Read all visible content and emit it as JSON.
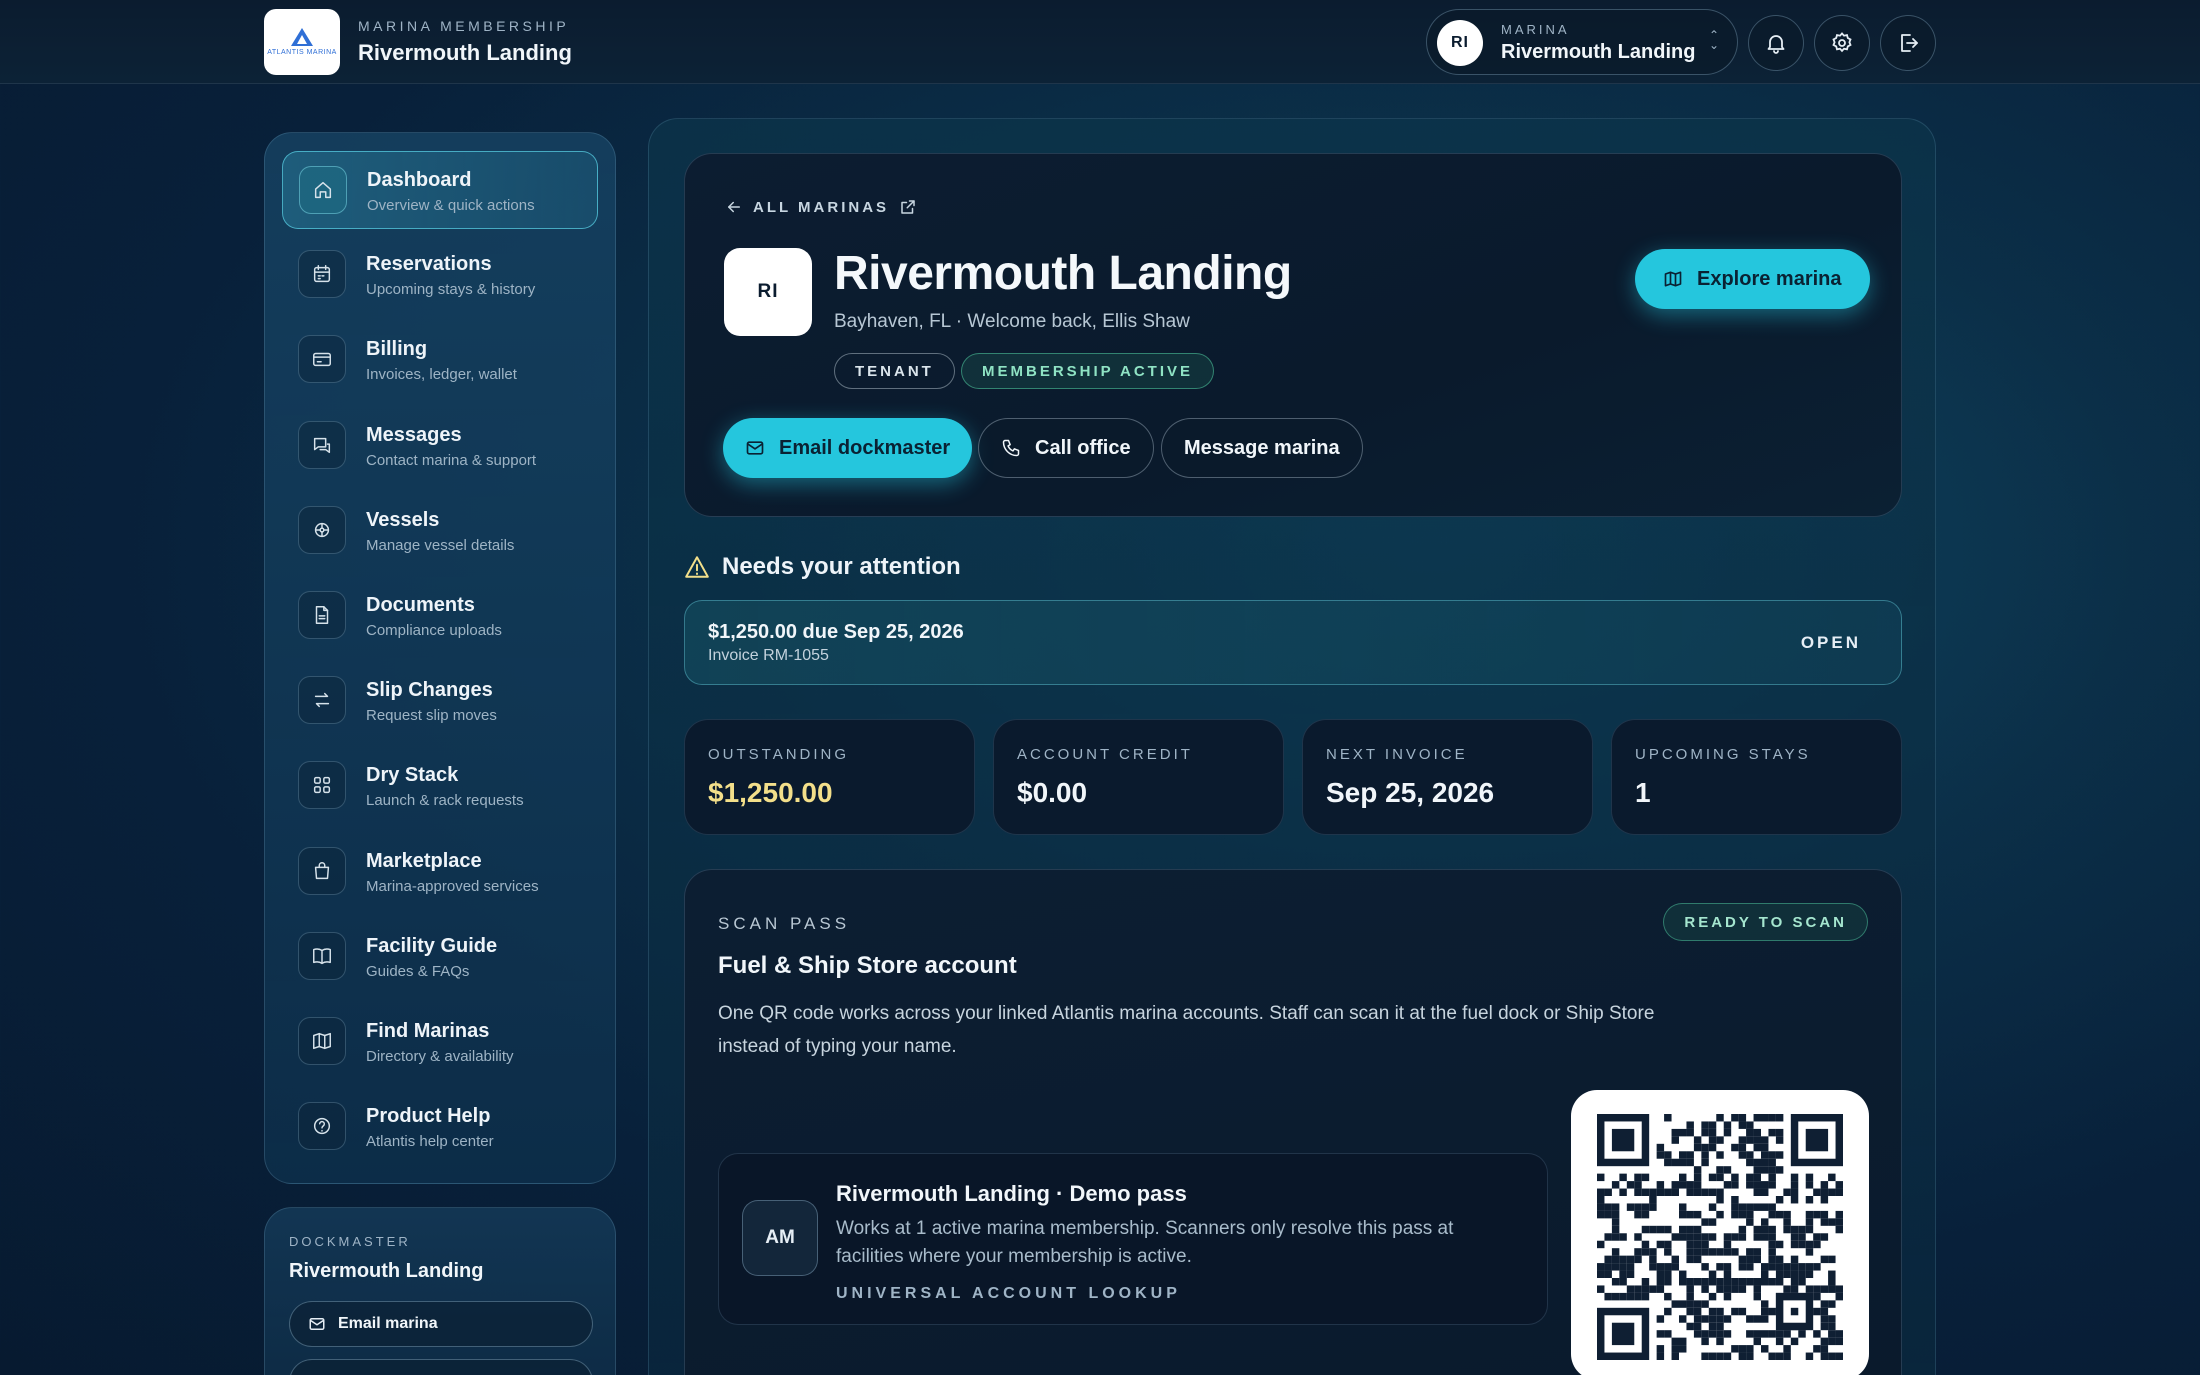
{
  "brand": {
    "logo_text": "ATLANTIS MARINA",
    "kicker": "MARINA MEMBERSHIP",
    "title": "Rivermouth Landing"
  },
  "marina_switcher": {
    "avatar": "RI",
    "kicker": "MARINA",
    "name": "Rivermouth Landing"
  },
  "header_icons": [
    "bell-icon",
    "gear-icon",
    "logout-icon"
  ],
  "sidebar": {
    "items": [
      {
        "label": "Dashboard",
        "sub": "Overview & quick actions",
        "icon": "home-icon",
        "active": true
      },
      {
        "label": "Reservations",
        "sub": "Upcoming stays & history",
        "icon": "calendar-icon"
      },
      {
        "label": "Billing",
        "sub": "Invoices, ledger, wallet",
        "icon": "credit-card-icon"
      },
      {
        "label": "Messages",
        "sub": "Contact marina & support",
        "icon": "chat-icon"
      },
      {
        "label": "Vessels",
        "sub": "Manage vessel details",
        "icon": "helm-icon"
      },
      {
        "label": "Documents",
        "sub": "Compliance uploads",
        "icon": "document-icon"
      },
      {
        "label": "Slip Changes",
        "sub": "Request slip moves",
        "icon": "swap-icon"
      },
      {
        "label": "Dry Stack",
        "sub": "Launch & rack requests",
        "icon": "grid-icon"
      },
      {
        "label": "Marketplace",
        "sub": "Marina-approved services",
        "icon": "bag-icon"
      },
      {
        "label": "Facility Guide",
        "sub": "Guides & FAQs",
        "icon": "book-icon"
      },
      {
        "label": "Find Marinas",
        "sub": "Directory & availability",
        "icon": "map-icon"
      },
      {
        "label": "Product Help",
        "sub": "Atlantis help center",
        "icon": "help-icon"
      }
    ]
  },
  "dockmaster": {
    "kicker": "DOCKMASTER",
    "name": "Rivermouth Landing",
    "email_label": "Email marina"
  },
  "hero": {
    "crumb": "ALL MARINAS",
    "avatar": "RI",
    "title": "Rivermouth Landing",
    "subtitle": "Bayhaven, FL · Welcome back, Ellis Shaw",
    "badges": [
      "TENANT",
      "MEMBERSHIP ACTIVE"
    ],
    "explore_label": "Explore marina",
    "actions": {
      "email": "Email dockmaster",
      "call": "Call office",
      "message": "Message marina"
    }
  },
  "attention": {
    "heading": "Needs your attention",
    "amount": "$1,250.00 due Sep 25, 2026",
    "invoice": "Invoice RM-1055",
    "status": "OPEN"
  },
  "stats": [
    {
      "key": "OUTSTANDING",
      "value": "$1,250.00",
      "highlight": true
    },
    {
      "key": "ACCOUNT CREDIT",
      "value": "$0.00"
    },
    {
      "key": "NEXT INVOICE",
      "value": "Sep 25, 2026"
    },
    {
      "key": "UPCOMING STAYS",
      "value": "1"
    }
  ],
  "scan": {
    "kicker": "SCAN PASS",
    "ready": "READY TO SCAN",
    "title": "Fuel & Ship Store account",
    "description": "One QR code works across your linked Atlantis marina accounts. Staff can scan it at the fuel dock or Ship Store instead of typing your name.",
    "pass": {
      "avatar": "AM",
      "title": "Rivermouth Landing · Demo pass",
      "description": "Works at 1 active marina membership. Scanners only resolve this pass at facilities where your membership is active.",
      "kicker": "UNIVERSAL ACCOUNT LOOKUP"
    }
  },
  "colors": {
    "accent": "#25c6dd",
    "warn": "#f3df8a",
    "success": "#8fe3c4",
    "bg": "#0b2f48"
  }
}
